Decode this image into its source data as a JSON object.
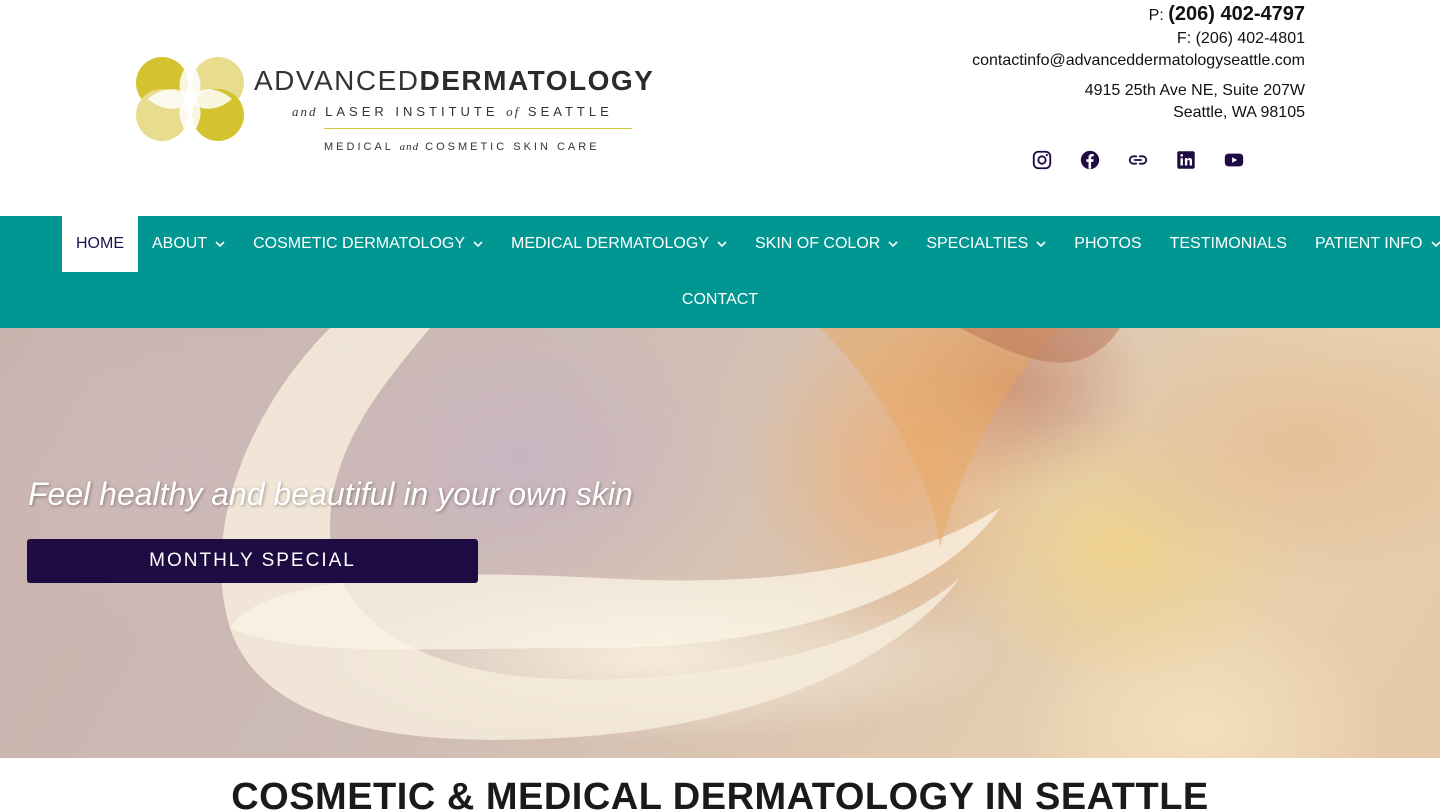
{
  "brand": {
    "line1_thin": "ADVANCED",
    "line1_bold": "DERMATOLOGY",
    "line2_and": "and",
    "line2_mid": "LASER INSTITUTE",
    "line2_of": "of",
    "line2_end": "SEATTLE",
    "line3_a": "MEDICAL",
    "line3_and": "and",
    "line3_b": "COSMETIC SKIN CARE",
    "colors": {
      "gold": "#d4c32e",
      "gold_light": "#e8dc8f"
    }
  },
  "contact": {
    "phone_prefix": "P:",
    "phone": "(206) 402-4797",
    "fax": "F: (206) 402-4801",
    "email": "contactinfo@advanceddermatologyseattle.com",
    "address1": "4915 25th Ave NE, Suite 207W",
    "address2": "Seattle, WA 98105"
  },
  "social": [
    "instagram-icon",
    "facebook-icon",
    "link-icon",
    "linkedin-icon",
    "youtube-icon"
  ],
  "nav": {
    "items": [
      {
        "label": "HOME",
        "active": true,
        "dropdown": false
      },
      {
        "label": "ABOUT",
        "dropdown": true
      },
      {
        "label": "COSMETIC DERMATOLOGY",
        "dropdown": true
      },
      {
        "label": "MEDICAL DERMATOLOGY",
        "dropdown": true
      },
      {
        "label": "SKIN OF COLOR",
        "dropdown": true
      },
      {
        "label": "SPECIALTIES",
        "dropdown": true
      },
      {
        "label": "PHOTOS",
        "dropdown": false
      },
      {
        "label": "TESTIMONIALS",
        "dropdown": false
      },
      {
        "label": "PATIENT INFO",
        "dropdown": true
      },
      {
        "label": "CONTACT",
        "dropdown": false
      }
    ],
    "colors": {
      "background": "#009691",
      "active_background": "#ffffff",
      "active_text": "#1e1150"
    }
  },
  "hero": {
    "tagline": "Feel healthy and beautiful in your own skin",
    "button_label": "MONTHLY SPECIAL",
    "button_color": "#1d0b42"
  },
  "section": {
    "title": "COSMETIC & MEDICAL DERMATOLOGY IN SEATTLE"
  }
}
